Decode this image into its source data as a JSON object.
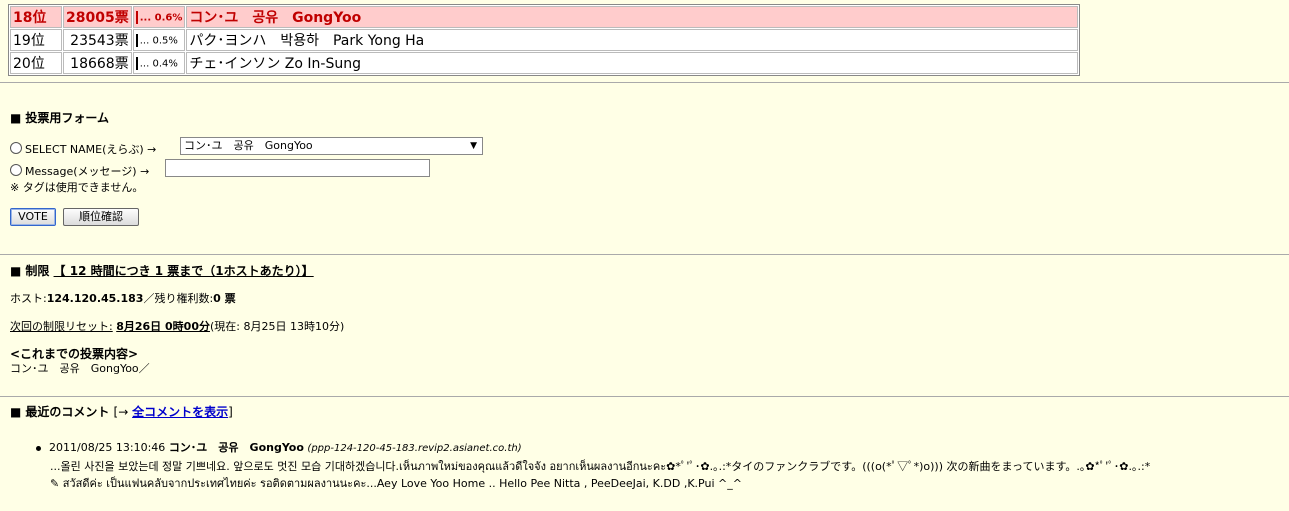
{
  "ranking": [
    {
      "rank": "18位",
      "votes": "28005票",
      "dots": "...",
      "percent": "0.6%",
      "name": "コン･ユ　공유　GongYoo",
      "highlight": true
    },
    {
      "rank": "19位",
      "votes": "23543票",
      "dots": "...",
      "percent": "0.5%",
      "name": "パク･ヨンハ　박용하　Park Yong Ha",
      "highlight": false
    },
    {
      "rank": "20位",
      "votes": "18668票",
      "dots": "...",
      "percent": "0.4%",
      "name": "チェ･インソン Zo In-Sung",
      "highlight": false
    }
  ],
  "form": {
    "square": "■",
    "title": "投票用フォーム",
    "select_label": "SELECT NAME(えらぶ) →",
    "select_value": "コン･ユ　공유　GongYoo",
    "message_label": "Message(メッセージ) →",
    "message_value": "",
    "tag_note": "※ タグは使用できません。",
    "vote_button": "VOTE",
    "rank_button": "順位確認"
  },
  "limit": {
    "title": "制限",
    "title_link": "【 12 時間につき 1 票まで（1ホストあたり）】",
    "host_label": "ホスト:",
    "host_value": "124.120.45.183",
    "remaining_label": "／残り権利数:",
    "remaining_value": "0 票",
    "reset_label": "次回の制限リセット:",
    "reset_value": "8月26日 0時00分",
    "current_time": "(現在: 8月25日 13時10分)",
    "history_title": "<これまでの投票内容>",
    "history_value": "コン･ユ　공유　GongYoo／"
  },
  "comments": {
    "title": "最近のコメント",
    "link_prefix": "[→ ",
    "link_text": "全コメントを表示",
    "link_suffix": "]",
    "items": [
      {
        "datetime": "2011/08/25 13:10:46",
        "name": "コン･ユ　공유　GongYoo",
        "host": "(ppp-124-120-45-183.revip2.asianet.co.th)",
        "line1": "...올린 사진을 보았는데 정말 기쁘네요. 앞으로도 멋진 모습 기대하겠습니다.เห็นภาพใหม่ของคุณแล้วดีใจจัง อยากเห็นผลงานอีกนะคะ✿*ﾟ'ﾟ･✿.｡.:*タイのファンクラブです。(((o(*ﾟ▽ﾟ*)o))) 次の新曲をまっています。.｡✿*ﾟ'ﾟ･✿.｡.:*",
        "line2": "✎ สวัสดีค่ะ เป็นแฟนคลับจากประเทศไทยค่ะ รอติดตามผลงานนะคะ...Aey Love Yoo Home .. Hello Pee Nitta , PeeDeeJai, K.DD ,K.Pui ^_^"
      }
    ]
  }
}
